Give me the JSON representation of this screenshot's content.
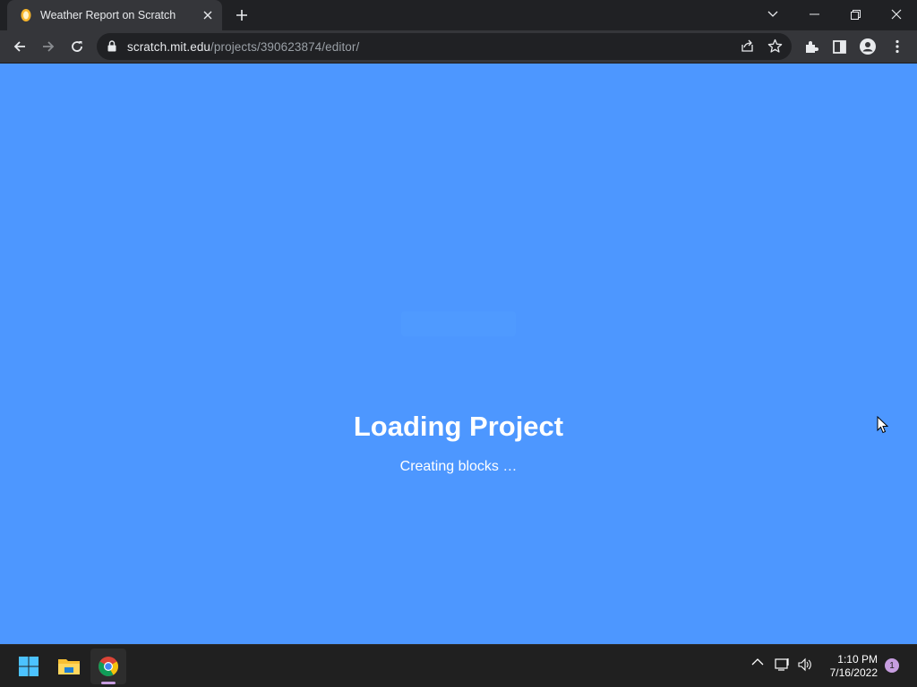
{
  "browser": {
    "tab": {
      "title": "Weather Report on Scratch",
      "favicon": "scratch-cat-icon"
    },
    "url": {
      "host": "scratch.mit.edu",
      "path": "/projects/390623874/editor/"
    },
    "icons": [
      "back-icon",
      "forward-icon",
      "reload-icon",
      "lock-icon",
      "share-icon",
      "star-icon",
      "extensions-icon",
      "side-panel-icon",
      "profile-icon",
      "menu-icon"
    ]
  },
  "page": {
    "title": "Loading Project",
    "status": "Creating blocks …",
    "background": "#4d97ff"
  },
  "taskbar": {
    "apps": [
      "windows-start-icon",
      "file-explorer-icon",
      "chrome-icon"
    ],
    "time": "1:10 PM",
    "date": "7/16/2022",
    "notification_count": "1"
  }
}
